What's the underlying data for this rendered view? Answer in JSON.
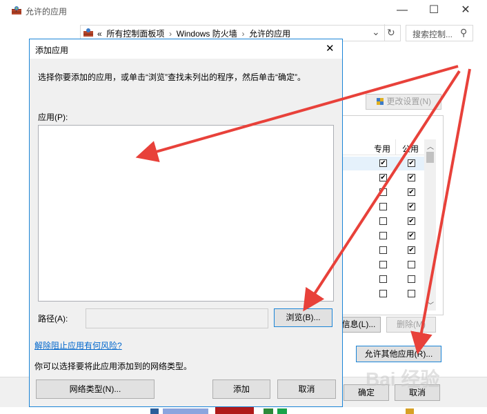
{
  "window": {
    "title": "允许的应用",
    "minimize_glyph": "—",
    "maximize_glyph": "☐",
    "close_glyph": "✕"
  },
  "address_bar": {
    "back_glyph": "←",
    "forward_glyph": "→",
    "up_glyph": "↑",
    "crumb_prefix": "«",
    "crumbs": [
      "所有控制面板项",
      "Windows 防火墙",
      "允许的应用"
    ],
    "separator": "›",
    "dropdown_glyph": "⌄",
    "refresh_glyph": "↻",
    "search_placeholder": "搜索控制...",
    "search_glyph": "⚲"
  },
  "background": {
    "change_settings_button": "更改设置(N)",
    "columns": {
      "private": "专用",
      "public": "公用"
    },
    "rows": [
      {
        "private": true,
        "public": true
      },
      {
        "private": true,
        "public": true
      },
      {
        "private": false,
        "public": true
      },
      {
        "private": false,
        "public": true
      },
      {
        "private": false,
        "public": true
      },
      {
        "private": false,
        "public": true
      },
      {
        "private": false,
        "public": true
      },
      {
        "private": false,
        "public": false
      },
      {
        "private": false,
        "public": false
      },
      {
        "private": false,
        "public": false
      }
    ],
    "details_button": "信息(L)...",
    "remove_button": "删除(M)",
    "allow_other_button": "允许其他应用(R)...",
    "ok_button": "确定",
    "cancel_button": "取消"
  },
  "dialog": {
    "title": "添加应用",
    "close_glyph": "✕",
    "instruction": "选择你要添加的应用，或单击“浏览”查找未列出的程序，然后单击“确定”。",
    "apps_label": "应用(P):",
    "path_label": "路径(A):",
    "path_value": "",
    "browse_button": "浏览(B)...",
    "risk_link": "解除阻止应用有何风险?",
    "network_hint": "你可以选择要将此应用添加到的网络类型。",
    "network_types_button": "网络类型(N)...",
    "add_button": "添加",
    "cancel_button": "取消"
  },
  "watermark": "Bai 经验",
  "colors": {
    "accent": "#1883d7",
    "arrow": "#e8413a",
    "link": "#0066cc"
  }
}
